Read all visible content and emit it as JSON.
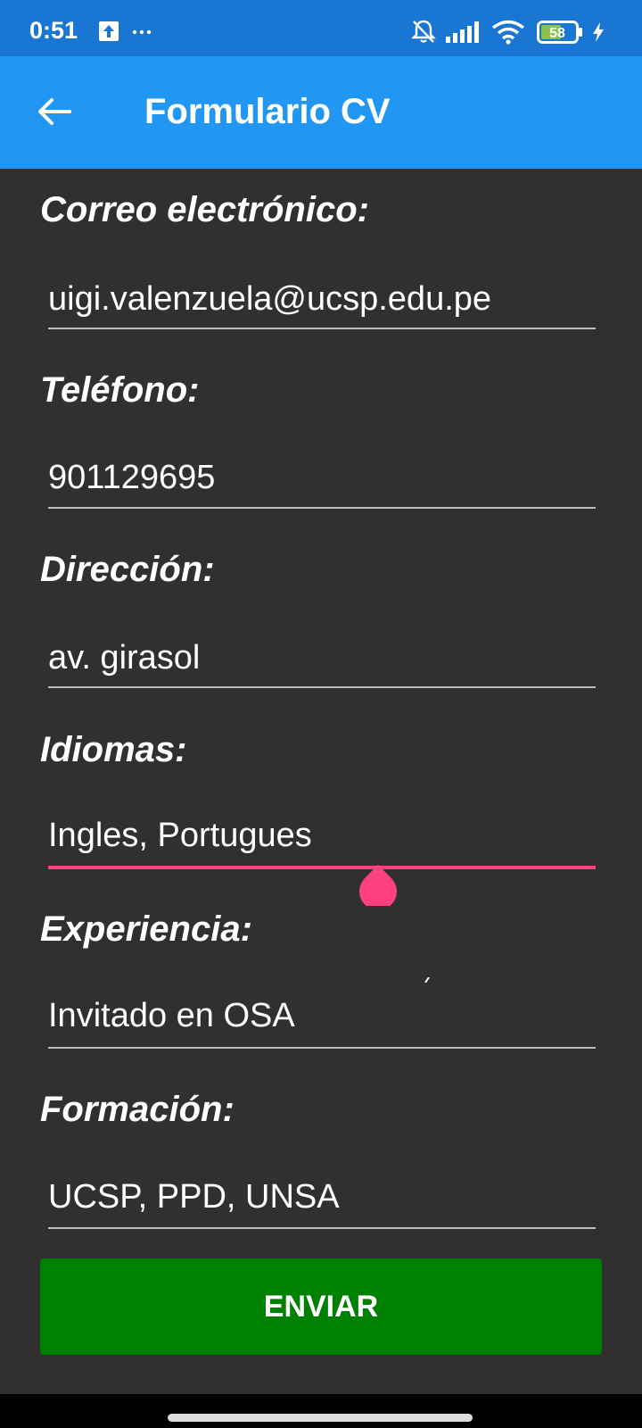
{
  "status_bar": {
    "time": "0:51",
    "battery_level": "58",
    "icons": [
      "upload-notification-icon",
      "more-notifications-icon",
      "bell-off-icon",
      "signal-icon",
      "wifi-icon",
      "battery-icon",
      "charging-icon"
    ]
  },
  "app_bar": {
    "title": "Formulario CV",
    "back_icon": "arrow-back-icon",
    "color": "#2196f3"
  },
  "form": {
    "fields": [
      {
        "label": "Correo electrónico:",
        "value": "uigi.valenzuela@ucsp.edu.pe"
      },
      {
        "label": "Teléfono:",
        "value": "901129695"
      },
      {
        "label": "Dirección:",
        "value": "av. girasol"
      },
      {
        "label": "Idiomas:",
        "value": "Ingles, Portugues",
        "focused": true
      },
      {
        "label": "Experiencia:",
        "value": "Invitado en OSA"
      },
      {
        "label": "Formación:",
        "value": "UCSP, PPD, UNSA"
      }
    ],
    "submit_label": "ENVIAR",
    "accent_color": "#ff4081",
    "button_color": "#008000",
    "background_color": "#303030"
  }
}
